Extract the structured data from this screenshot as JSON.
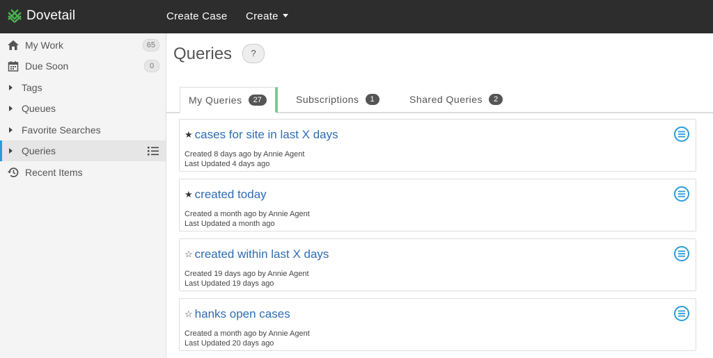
{
  "app": {
    "name": "Dovetail"
  },
  "topnav": {
    "create_case": "Create Case",
    "create": "Create"
  },
  "sidebar": {
    "items": [
      {
        "label": "My Work",
        "badge": "65",
        "icon": "home-icon"
      },
      {
        "label": "Due Soon",
        "badge": "0",
        "icon": "calendar-icon"
      },
      {
        "label": "Tags",
        "icon": "caret-right-icon"
      },
      {
        "label": "Queues",
        "icon": "caret-right-icon"
      },
      {
        "label": "Favorite Searches",
        "icon": "caret-right-icon"
      },
      {
        "label": "Queries",
        "icon": "caret-right-icon",
        "active": true
      },
      {
        "label": "Recent Items",
        "icon": "history-icon"
      }
    ]
  },
  "page": {
    "title": "Queries",
    "help_label": "?"
  },
  "tabs": [
    {
      "label": "My Queries",
      "count": "27",
      "active": true
    },
    {
      "label": "Subscriptions",
      "count": "1"
    },
    {
      "label": "Shared Queries",
      "count": "2"
    }
  ],
  "queries": [
    {
      "star": "★",
      "title": "cases for site in last X days",
      "created": "Created 8 days ago by Annie Agent",
      "updated": "Last Updated 4 days ago"
    },
    {
      "star": "★",
      "title": "created today",
      "created": "Created a month ago by Annie Agent",
      "updated": "Last Updated a month ago"
    },
    {
      "star": "☆",
      "title": "created within last X days",
      "created": "Created 19 days ago by Annie Agent",
      "updated": "Last Updated 19 days ago"
    },
    {
      "star": "☆",
      "title": "hanks open cases",
      "created": "Created a month ago by Annie Agent",
      "updated": "Last Updated 20 days ago"
    }
  ],
  "colors": {
    "topbar": "#2d2d2d",
    "link": "#2e6cb5",
    "accent": "#2b9bd8",
    "active_tab": "#6fcf97"
  }
}
